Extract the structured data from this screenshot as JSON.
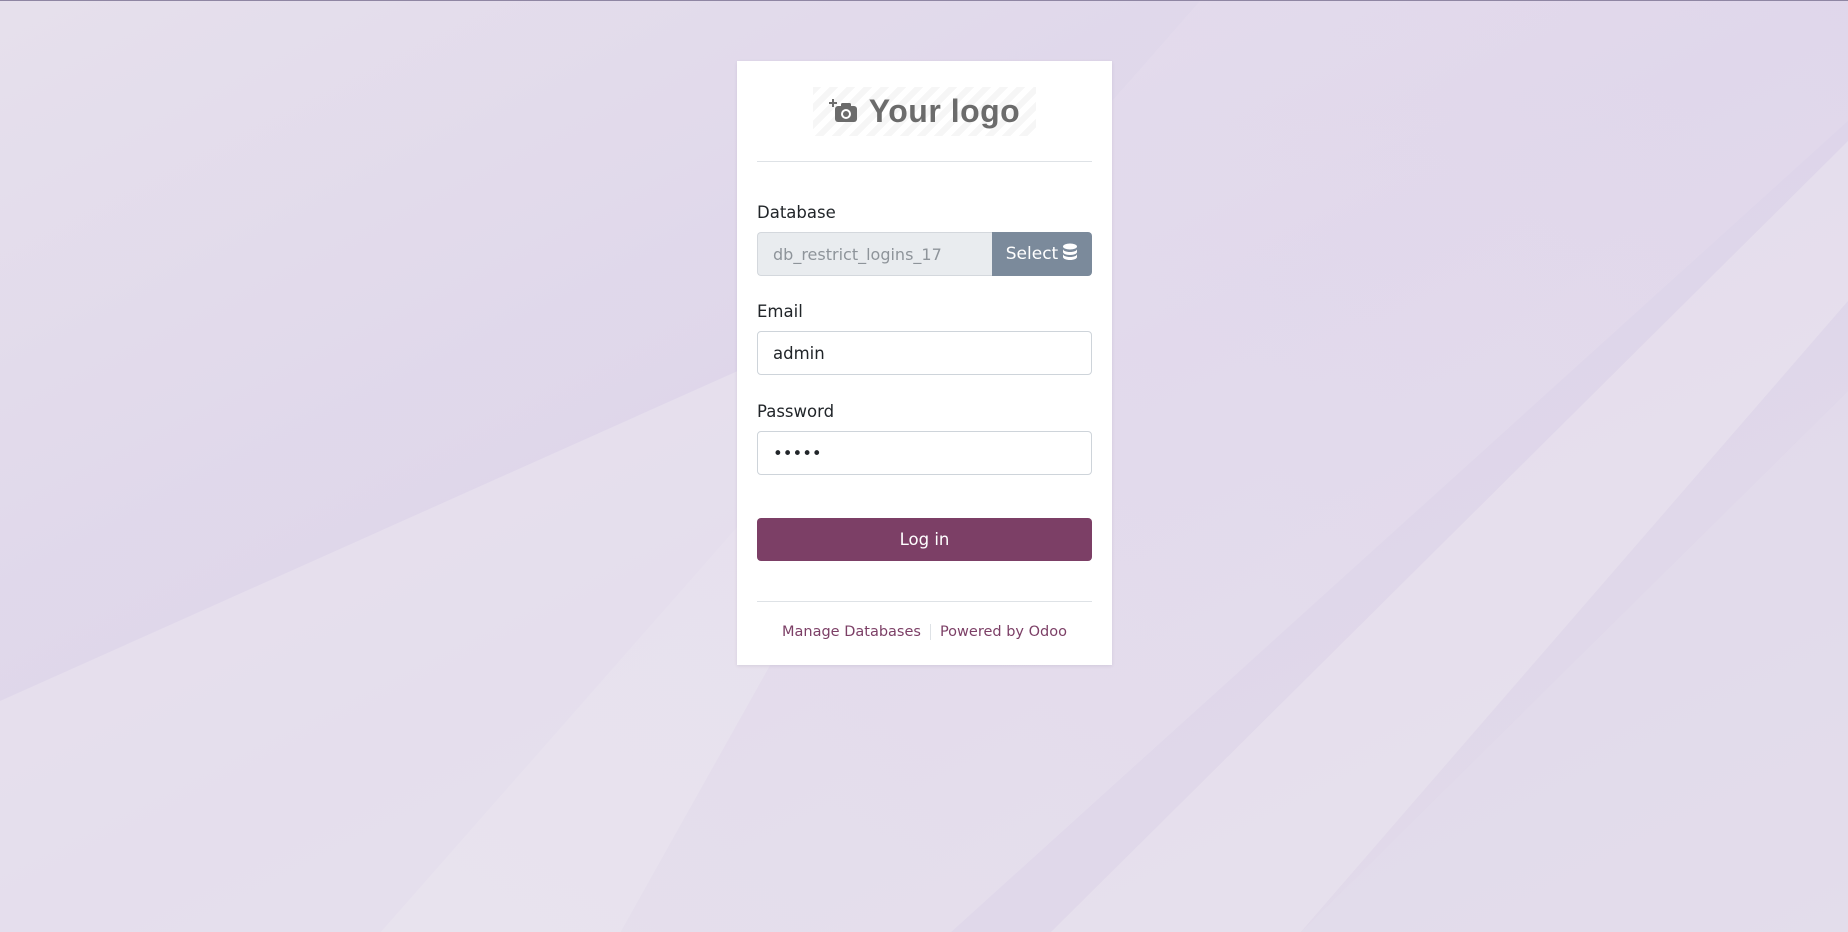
{
  "logo": {
    "text": "Your logo",
    "icon": "camera-plus-icon"
  },
  "form": {
    "database": {
      "label": "Database",
      "value": "db_restrict_logins_17",
      "select_label": "Select",
      "select_icon": "database-icon"
    },
    "email": {
      "label": "Email",
      "value": "admin"
    },
    "password": {
      "label": "Password",
      "value": "•••••"
    },
    "login_label": "Log in"
  },
  "footer": {
    "manage_databases": "Manage Databases",
    "powered_by": "Powered by ",
    "brand": "Odoo"
  },
  "colors": {
    "brand": "#7c3f66",
    "select_button": "#7b8a9b",
    "background": "#dcd4e6"
  }
}
